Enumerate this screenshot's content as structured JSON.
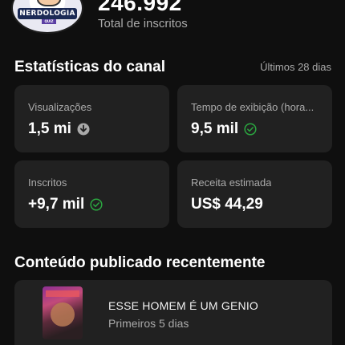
{
  "channel": {
    "avatar_text": "NERDOLOGIA",
    "avatar_subtext": "QUIZ",
    "subscriber_count": "246.992",
    "subscriber_label": "Total de inscritos"
  },
  "stats": {
    "title": "Estatísticas do canal",
    "period": "Últimos 28 dias",
    "cards": [
      {
        "label": "Visualizações",
        "value": "1,5 mi",
        "trend_icon": "arrow-down-circle-icon",
        "trend": "down"
      },
      {
        "label": "Tempo de exibição (hora...",
        "value": "9,5 mil",
        "trend_icon": "check-circle-icon",
        "trend": "normal"
      },
      {
        "label": "Inscritos",
        "value": "+9,7 mil",
        "trend_icon": "check-circle-icon",
        "trend": "normal"
      },
      {
        "label": "Receita estimada",
        "value": "US$ 44,29"
      }
    ]
  },
  "recent": {
    "title": "Conteúdo publicado recentemente",
    "items": [
      {
        "title": "ESSE HOMEM É UM GENIO",
        "subtitle": "Primeiros 5 dias"
      }
    ]
  },
  "colors": {
    "background": "#0f0f0f",
    "card": "#212121",
    "positive": "#2ba640",
    "muted": "#aaaaaa"
  }
}
